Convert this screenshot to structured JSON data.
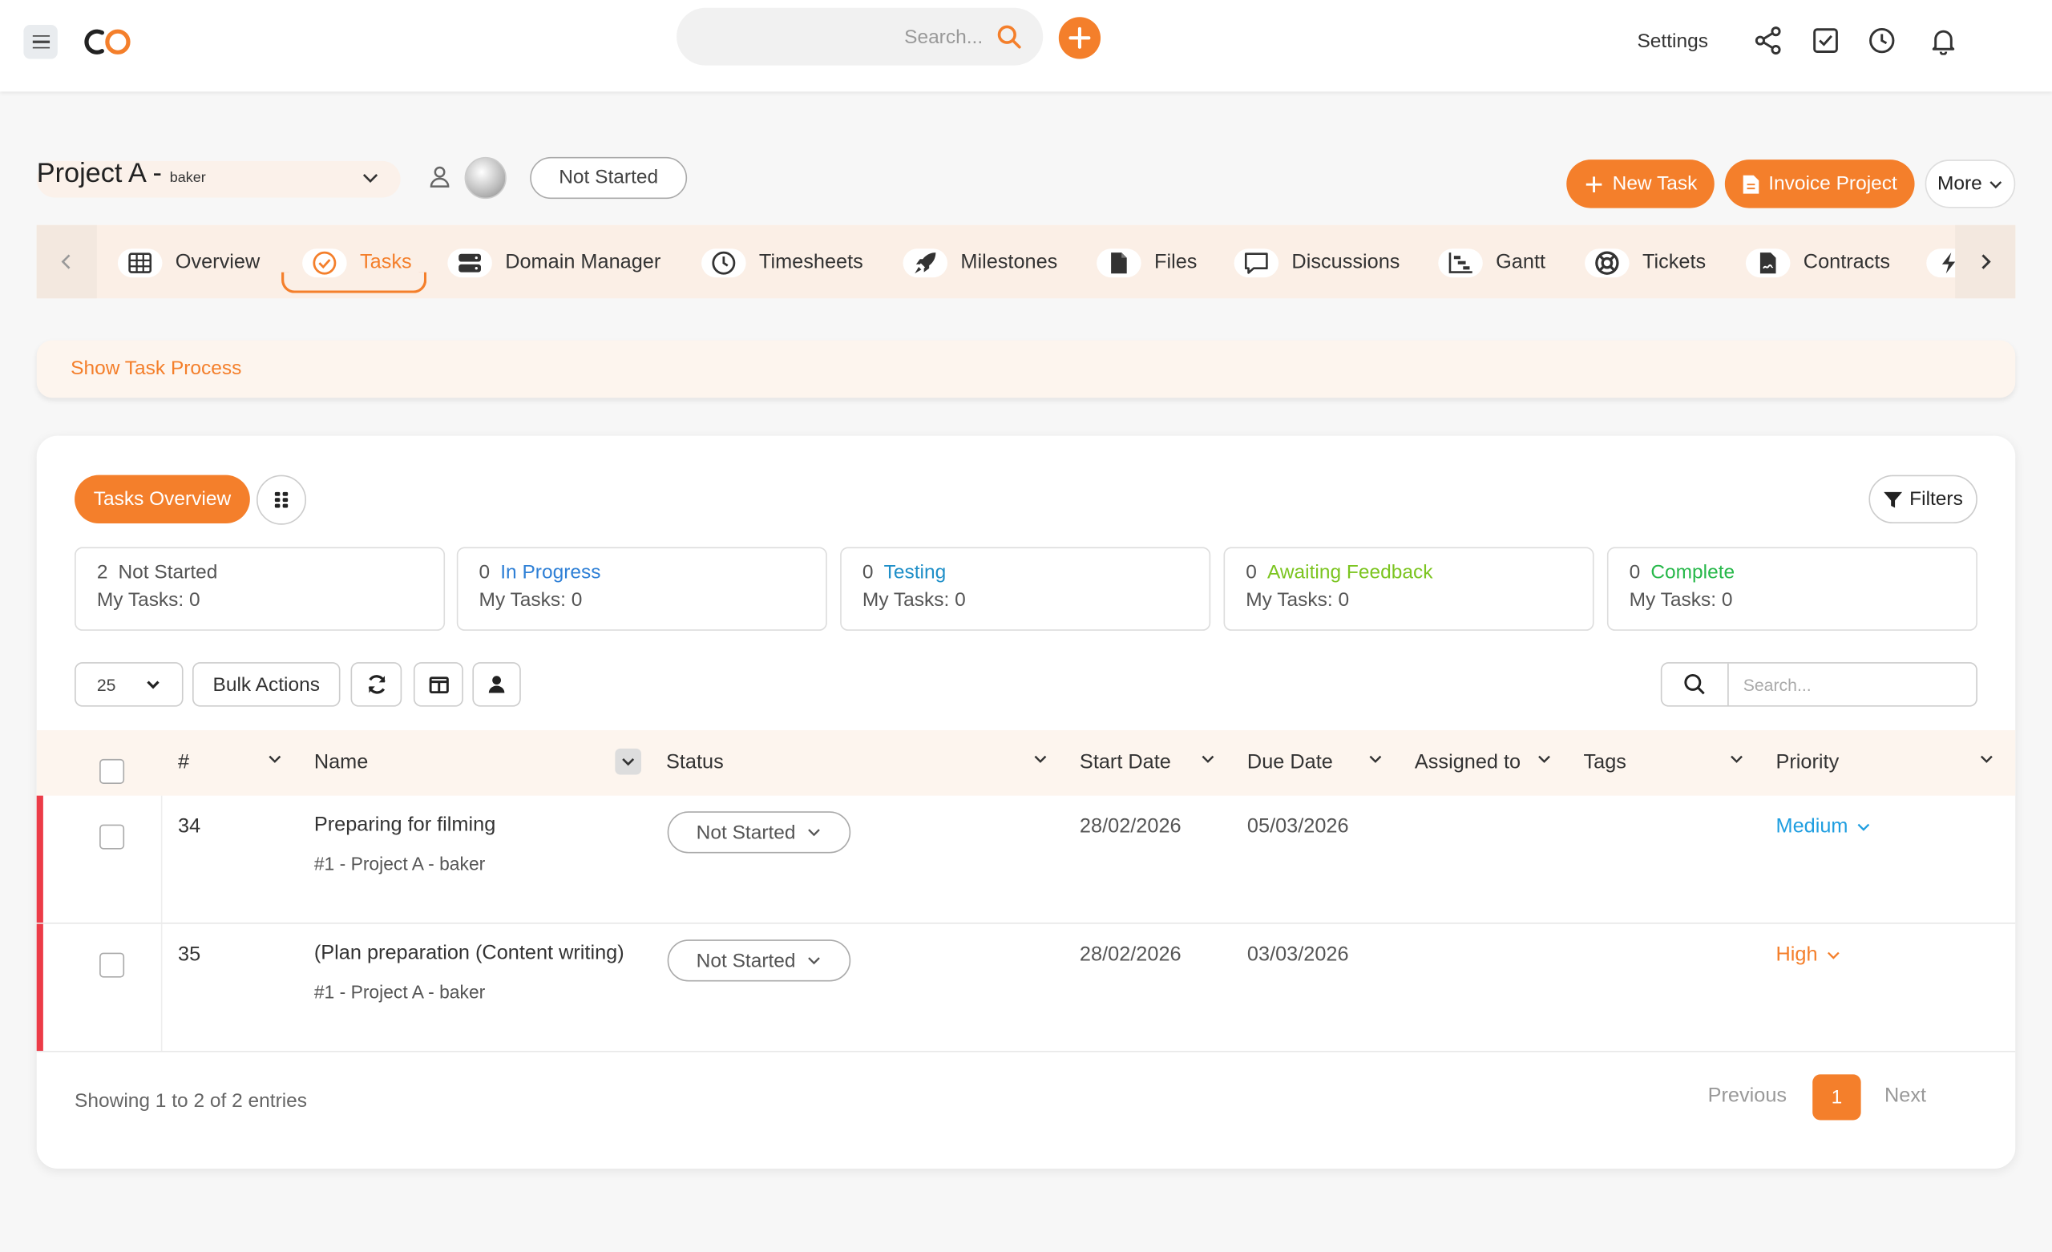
{
  "topbar": {
    "search_placeholder": "Search...",
    "settings_label": "Settings",
    "icons": [
      "menu-icon",
      "share-icon",
      "checkbox-icon",
      "clock-icon",
      "bell-icon",
      "search-icon",
      "plus-icon"
    ]
  },
  "project": {
    "title": "Project A -",
    "client": "baker",
    "status": "Not Started"
  },
  "actions": {
    "new_task": "New Task",
    "invoice_project": "Invoice Project",
    "more": "More"
  },
  "tabs": [
    {
      "label": "Overview",
      "icon": "table-icon"
    },
    {
      "label": "Tasks",
      "icon": "check-circle-icon",
      "active": true
    },
    {
      "label": "Domain Manager",
      "icon": "server-icon"
    },
    {
      "label": "Timesheets",
      "icon": "clock-icon"
    },
    {
      "label": "Milestones",
      "icon": "rocket-icon"
    },
    {
      "label": "Files",
      "icon": "file-icon"
    },
    {
      "label": "Discussions",
      "icon": "comment-icon"
    },
    {
      "label": "Gantt",
      "icon": "gantt-icon"
    },
    {
      "label": "Tickets",
      "icon": "lifering-icon"
    },
    {
      "label": "Contracts",
      "icon": "contract-icon"
    }
  ],
  "process": {
    "label": "Show Task Process"
  },
  "overview": {
    "tasks_overview_label": "Tasks Overview",
    "filters_label": "Filters",
    "stats": [
      {
        "count": "2",
        "label": "Not Started",
        "my_tasks": "My Tasks: 0",
        "color": "#555555"
      },
      {
        "count": "0",
        "label": "In Progress",
        "my_tasks": "My Tasks: 0",
        "color": "#2f80d6"
      },
      {
        "count": "0",
        "label": "Testing",
        "my_tasks": "My Tasks: 0",
        "color": "#1f8fc8"
      },
      {
        "count": "0",
        "label": "Awaiting Feedback",
        "my_tasks": "My Tasks: 0",
        "color": "#7cc521"
      },
      {
        "count": "0",
        "label": "Complete",
        "my_tasks": "My Tasks: 0",
        "color": "#27b84a"
      }
    ]
  },
  "toolbar": {
    "page_length": "25",
    "bulk_actions": "Bulk Actions",
    "search_placeholder": "Search..."
  },
  "table": {
    "columns": [
      "#",
      "Name",
      "Status",
      "Start Date",
      "Due Date",
      "Assigned to",
      "Tags",
      "Priority"
    ],
    "rows": [
      {
        "id": "34",
        "name": "Preparing for filming",
        "sub": "#1 - Project A - baker",
        "status": "Not Started",
        "start": "28/02/2026",
        "due": "05/03/2026",
        "priority": "Medium",
        "priority_color": "#1f9ee0"
      },
      {
        "id": "35",
        "name": "(Plan preparation (Content writing)",
        "sub": "#1 - Project A - baker",
        "status": "Not Started",
        "start": "28/02/2026",
        "due": "03/03/2026",
        "priority": "High",
        "priority_color": "#f47f2b"
      }
    ]
  },
  "footer": {
    "info": "Showing 1 to 2 of 2 entries",
    "previous": "Previous",
    "page": "1",
    "next": "Next"
  },
  "colors": {
    "accent": "#f47f2b",
    "overdue_flag": "#ec3b47"
  }
}
